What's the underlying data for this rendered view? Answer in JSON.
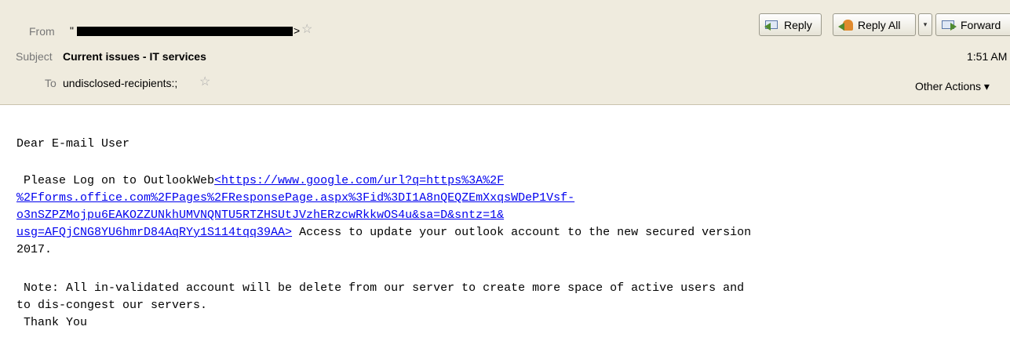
{
  "header": {
    "from_label": "From",
    "from_value": "\"",
    "from_suffix": ">",
    "subject_label": "Subject",
    "subject_value": "Current issues - IT services",
    "to_label": "To",
    "to_value": "undisclosed-recipients:;",
    "time": "1:51 AM",
    "other_actions": "Other Actions ▾",
    "buttons": {
      "reply": "Reply",
      "reply_all": "Reply All",
      "dropdown": "▾",
      "forward": "Forward"
    },
    "colors": {
      "header_bg": "#efebde",
      "link": "#0000ee"
    }
  },
  "body": {
    "greeting": "Dear E-mail User",
    "p1_prefix": " Please Log on to OutlookWeb",
    "p1_link_1": "<https://www.google.com/url?q=https%3A%2F",
    "p1_link_2": "%2Fforms.office.com%2FPages%2FResponsePage.aspx%3Fid%3DI1A8nQEQZEmXxqsWDeP1Vsf-",
    "p1_link_3": "o3nSZPZMojpu6EAKOZZUNkhUMVNQNTU5RTZHSUtJVzhERzcwRkkwOS4u&sa=D&sntz=1&",
    "p1_link_4": "usg=AFQjCNG8YU6hmrD84AqRYy1S114tqq39AA>",
    "p1_suffix": " Access to update your outlook account to the new secured version",
    "p1_line_5": "2017.",
    "note_1": " Note: All in-validated account will be delete from our server to create more space of active users and",
    "note_2": "to dis-congest our servers.",
    "thanks": " Thank You"
  }
}
